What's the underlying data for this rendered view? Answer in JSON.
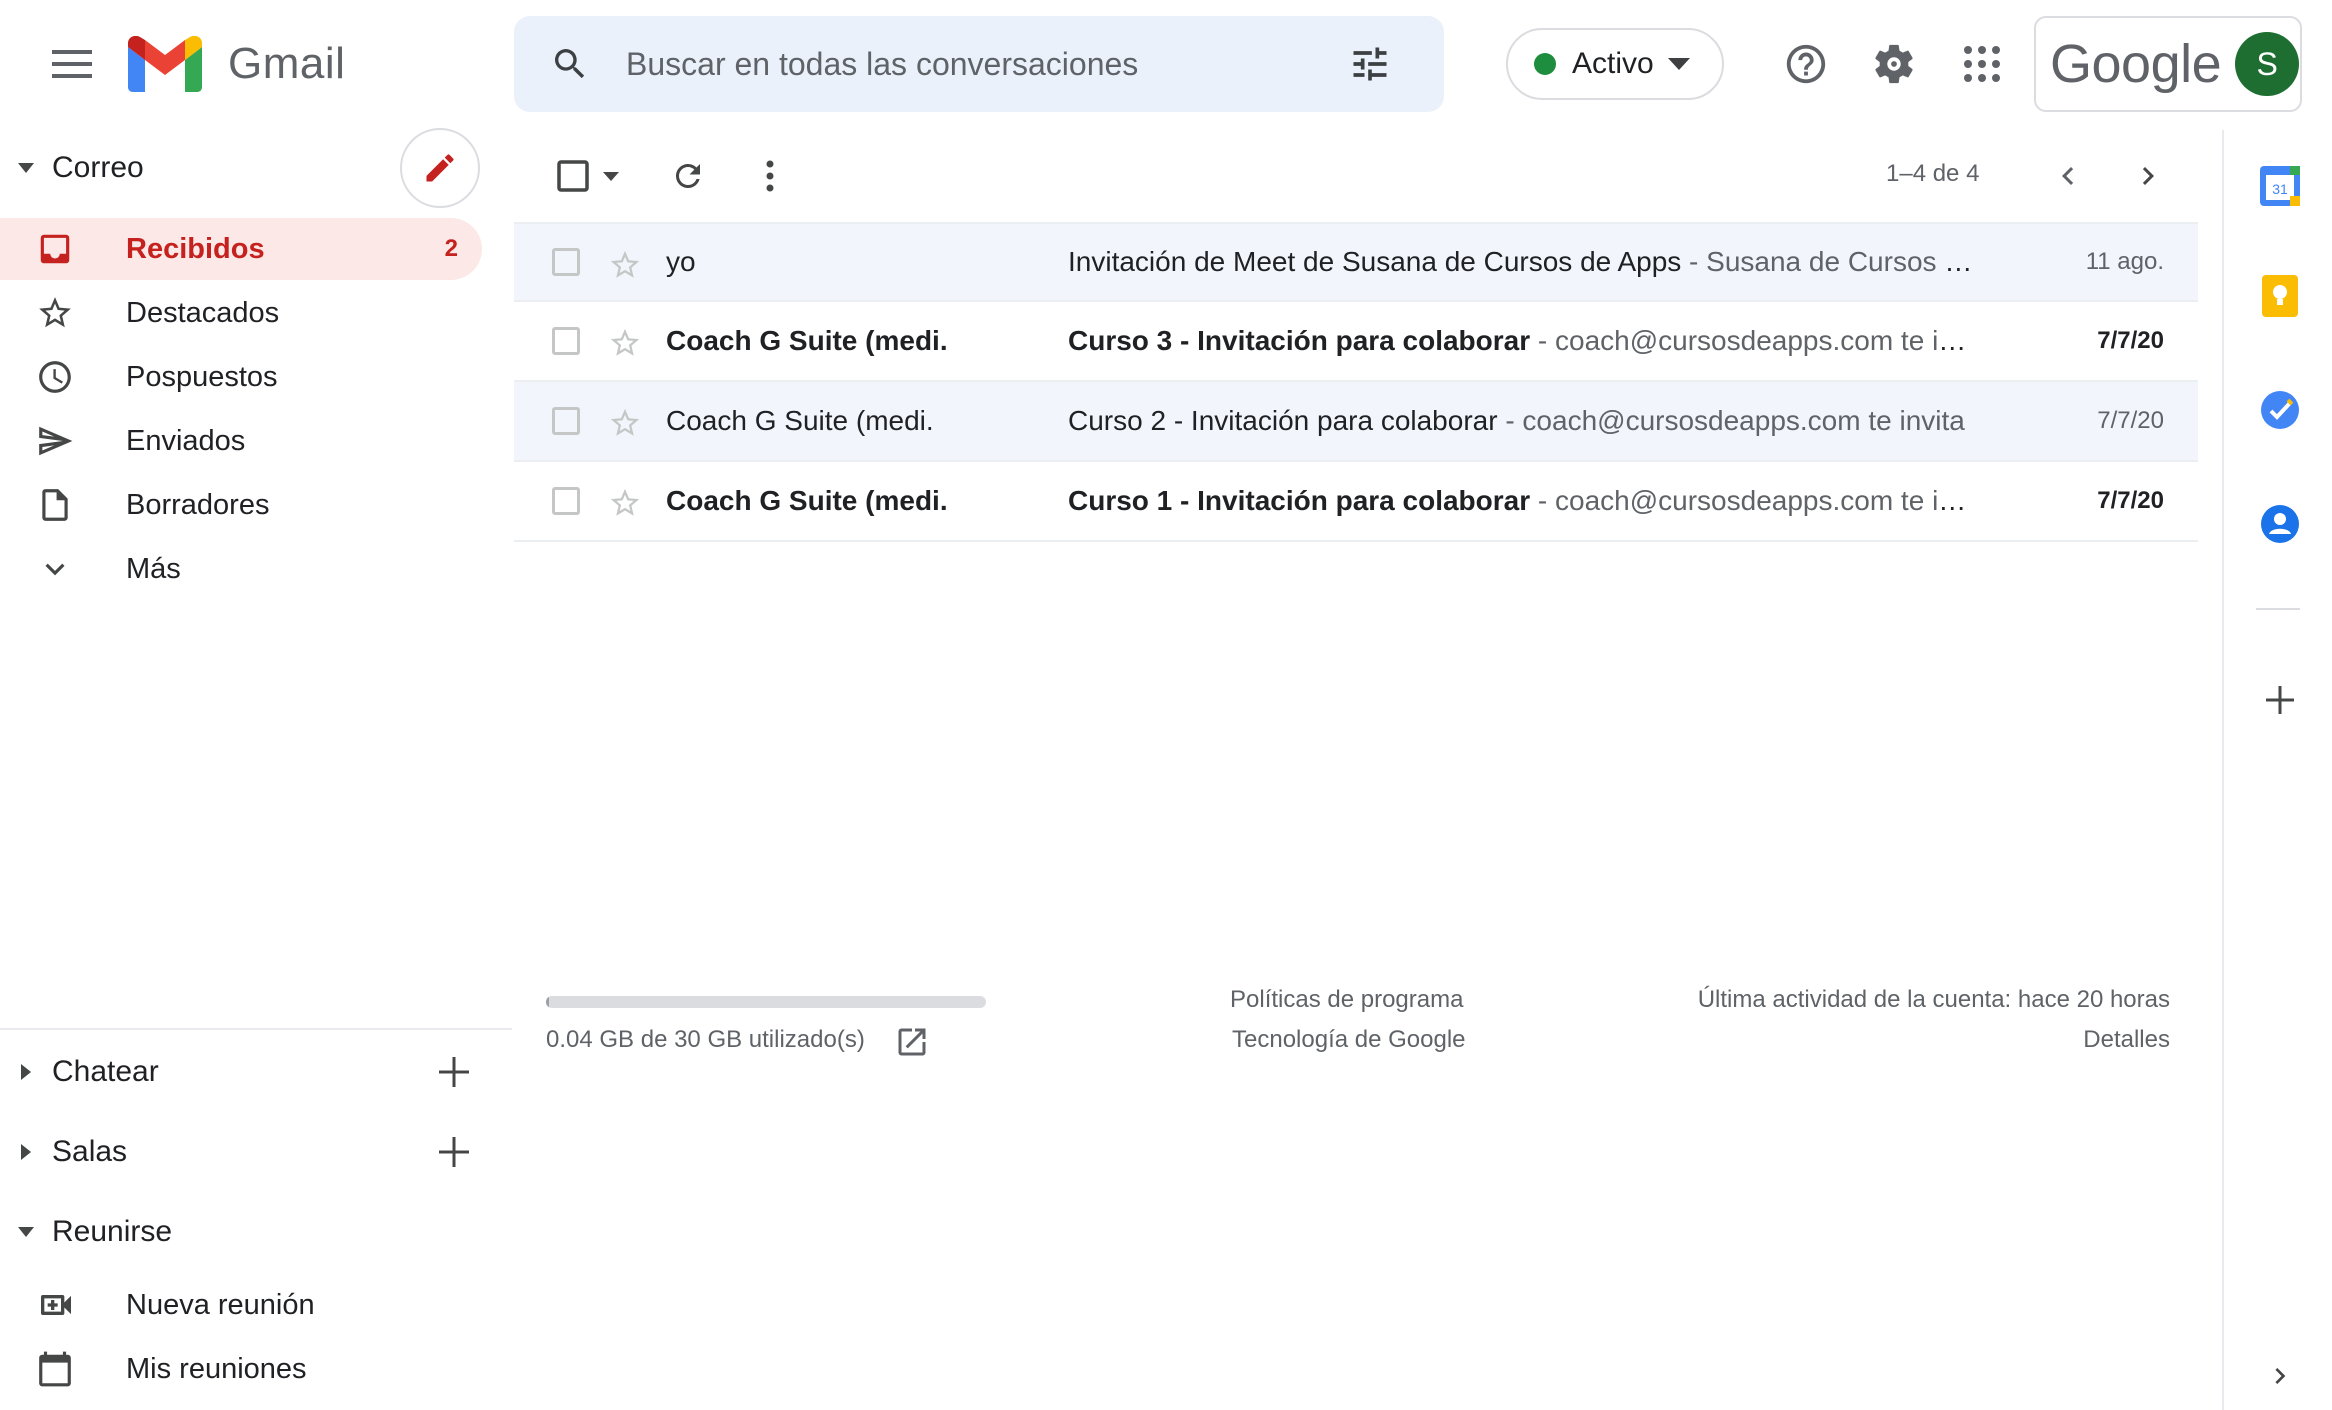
{
  "header": {
    "app_name": "Gmail",
    "search_placeholder": "Buscar en todas las conversaciones",
    "status_label": "Activo",
    "status_color": "#1e8e3e",
    "google_label": "Google",
    "avatar_initial": "S",
    "icons": [
      "main-menu-icon",
      "search-icon",
      "search-options-icon",
      "help-icon",
      "settings-icon",
      "apps-icon"
    ]
  },
  "sidebar": {
    "mail_section": "Correo",
    "items": [
      {
        "label": "Recibidos",
        "count": "2",
        "icon": "inbox-icon",
        "active": true
      },
      {
        "label": "Destacados",
        "icon": "star-icon"
      },
      {
        "label": "Pospuestos",
        "icon": "clock-icon"
      },
      {
        "label": "Enviados",
        "icon": "send-icon"
      },
      {
        "label": "Borradores",
        "icon": "draft-icon"
      },
      {
        "label": "Más",
        "icon": "chevron-down-icon"
      }
    ],
    "chat_section": "Chatear",
    "rooms_section": "Salas",
    "meet_section": "Reunirse",
    "meet_items": [
      {
        "label": "Nueva reunión",
        "icon": "video-add-icon"
      },
      {
        "label": "Mis reuniones",
        "icon": "calendar-icon"
      }
    ]
  },
  "toolbar": {
    "pagination": "1–4 de 4"
  },
  "emails": [
    {
      "sender": "yo",
      "subject": "Invitación de Meet de Susana de Cursos de Apps",
      "snippet": " - Susana de Cursos de Apps te invita a una videollamada de Meet",
      "date": "11 ago.",
      "unread": false
    },
    {
      "sender": "Coach G Suite (medi.",
      "subject": "Curso 3 - Invitación para colaborar",
      "snippet": " - coach@cursosdeapps.com te invita",
      "date": "7/7/20",
      "unread": true
    },
    {
      "sender": "Coach G Suite (medi.",
      "subject": "Curso 2 - Invitación para colaborar",
      "snippet": " - coach@cursosdeapps.com te invita",
      "date": "7/7/20",
      "unread": false
    },
    {
      "sender": "Coach G Suite (medi.",
      "subject": "Curso 1 - Invitación para colaborar",
      "snippet": " - coach@cursosdeapps.com te invita",
      "date": "7/7/20",
      "unread": true
    }
  ],
  "footer": {
    "storage_used_fraction": 0.0013,
    "storage_text": "0.04 GB de 30 GB utilizado(s)",
    "program_policies": "Políticas de programa",
    "google_tech": "Tecnología de Google",
    "last_activity": "Última actividad de la cuenta: hace 20 horas",
    "details": "Detalles"
  },
  "side_panel": {
    "calendar_day": "31",
    "icons": [
      "calendar-app-icon",
      "keep-app-icon",
      "tasks-app-icon",
      "contacts-app-icon",
      "add-app-icon",
      "expand-panel-icon"
    ]
  },
  "colors": {
    "accent_red": "#c5221f",
    "active_bg": "#fce8e6",
    "search_bg": "#eaf1fb",
    "read_row_bg": "#f2f6fc"
  }
}
